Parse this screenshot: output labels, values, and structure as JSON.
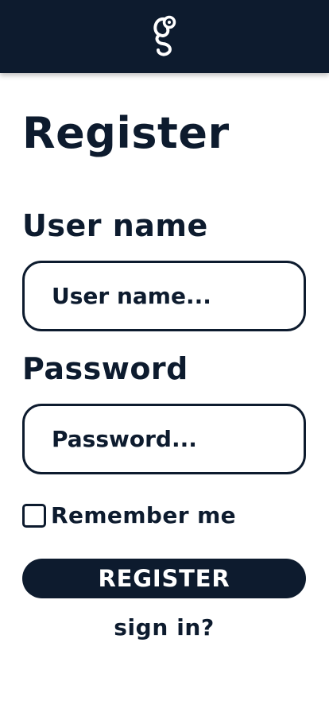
{
  "header": {
    "logo_icon": "g-worm-logo-icon",
    "background_color": "#0d1b2e"
  },
  "form": {
    "title": "Register",
    "username_label": "User name",
    "username_placeholder": "User name...",
    "username_value": "",
    "password_label": "Password",
    "password_placeholder": "Password...",
    "password_value": "",
    "remember_label": "Remember me",
    "remember_checked": false,
    "submit_label": "REGISTER",
    "alt_link_label": "sign in?"
  },
  "colors": {
    "primary": "#0d1b2e",
    "background": "#ffffff",
    "button_text": "#ffffff"
  }
}
